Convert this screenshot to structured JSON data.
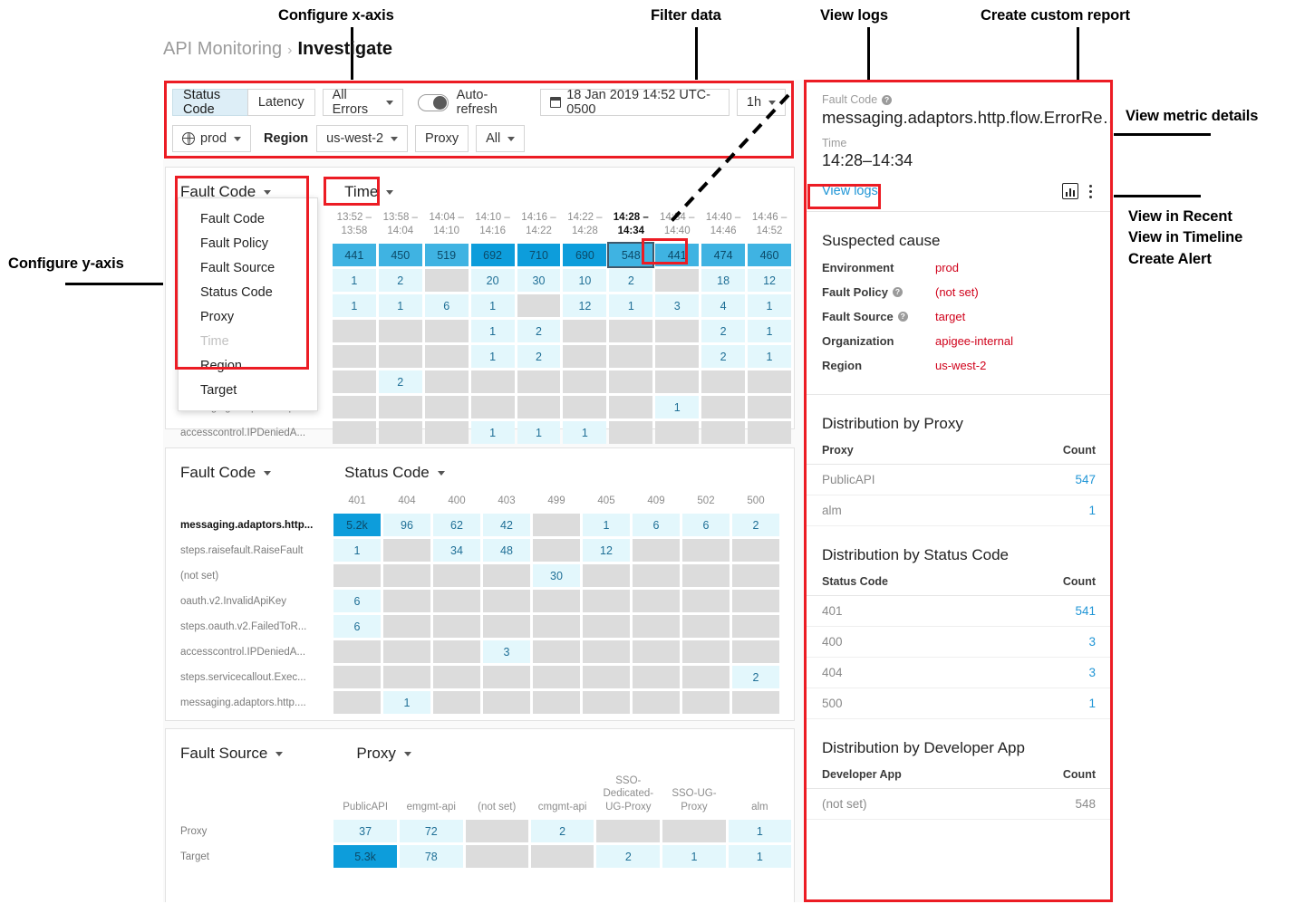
{
  "breadcrumb": {
    "root": "API Monitoring",
    "sep": "›",
    "current": "Investigate"
  },
  "annotations": [
    {
      "name": "configure-x-axis",
      "label": "Configure x-axis"
    },
    {
      "name": "filter-data",
      "label": "Filter data"
    },
    {
      "name": "view-logs",
      "label": "View logs"
    },
    {
      "name": "create-custom-report",
      "label": "Create custom report"
    },
    {
      "name": "view-metric-details",
      "label": "View metric details"
    },
    {
      "name": "view-in-recent",
      "label": "View in Recent"
    },
    {
      "name": "view-in-timeline",
      "label": "View in Timeline"
    },
    {
      "name": "create-alert",
      "label": "Create Alert"
    },
    {
      "name": "configure-y-axis",
      "label": "Configure y-axis"
    }
  ],
  "toolbar": {
    "metric_tabs": [
      {
        "label": "Status Code",
        "active": true
      },
      {
        "label": "Latency",
        "active": false
      }
    ],
    "errors_filter": "All Errors",
    "auto_refresh_label": "Auto-refresh",
    "auto_refresh_on": false,
    "date_range": "18 Jan 2019 14:52 UTC-0500",
    "window": "1h",
    "environment": "prod",
    "region_label": "Region",
    "region_value": "us-west-2",
    "proxy_label": "Proxy",
    "proxy_value": "All"
  },
  "ydropdown": {
    "trigger": "Fault Code",
    "options": [
      {
        "label": "Fault Code",
        "disabled": false
      },
      {
        "label": "Fault Policy",
        "disabled": false
      },
      {
        "label": "Fault Source",
        "disabled": false
      },
      {
        "label": "Status Code",
        "disabled": false
      },
      {
        "label": "Proxy",
        "disabled": false
      },
      {
        "label": "Time",
        "disabled": true
      },
      {
        "label": "Region",
        "disabled": false
      },
      {
        "label": "Target",
        "disabled": false
      }
    ]
  },
  "chart_data": [
    {
      "type": "heatmap",
      "name": "fault-code-by-time",
      "ylabel": "Fault Code",
      "xlabel": "Time",
      "categories": [
        "13:52 – 13:58",
        "13:58 – 14:04",
        "14:04 – 14:10",
        "14:10 – 14:16",
        "14:16 – 14:22",
        "14:22 – 14:28",
        "14:28 – 14:34",
        "14:34 – 14:40",
        "14:40 – 14:46",
        "14:46 – 14:52"
      ],
      "highlighted_column": 6,
      "selected_cell": {
        "row": 0,
        "col": 6
      },
      "marked_cell": {
        "row": 0,
        "col": 7
      },
      "rows": [
        {
          "label": "",
          "values": [
            441,
            450,
            519,
            692,
            710,
            690,
            548,
            441,
            474,
            460
          ]
        },
        {
          "label": "",
          "values": [
            1,
            2,
            null,
            20,
            30,
            10,
            2,
            null,
            18,
            12
          ]
        },
        {
          "label": "",
          "values": [
            1,
            1,
            6,
            1,
            null,
            12,
            1,
            3,
            4,
            1
          ]
        },
        {
          "label": "",
          "values": [
            null,
            null,
            null,
            1,
            2,
            null,
            null,
            null,
            2,
            1
          ]
        },
        {
          "label": "",
          "values": [
            null,
            null,
            null,
            1,
            2,
            null,
            null,
            null,
            2,
            1
          ]
        },
        {
          "label": "",
          "values": [
            null,
            2,
            null,
            null,
            null,
            null,
            null,
            null,
            null,
            null
          ]
        },
        {
          "label": "messaging.adaptors.http....",
          "values": [
            null,
            null,
            null,
            null,
            null,
            null,
            null,
            1,
            null,
            null
          ]
        },
        {
          "label": "accesscontrol.IPDeniedA...",
          "values": [
            null,
            null,
            null,
            1,
            1,
            1,
            null,
            null,
            null,
            null
          ]
        }
      ]
    },
    {
      "type": "heatmap",
      "name": "fault-code-by-status-code",
      "ylabel": "Fault Code",
      "xlabel": "Status Code",
      "categories": [
        "401",
        "404",
        "400",
        "403",
        "499",
        "405",
        "409",
        "502",
        "500"
      ],
      "rows": [
        {
          "label": "messaging.adaptors.http...",
          "bold": true,
          "values": [
            "5.2k",
            96,
            62,
            42,
            null,
            1,
            6,
            6,
            2
          ]
        },
        {
          "label": "steps.raisefault.RaiseFault",
          "values": [
            1,
            null,
            34,
            48,
            null,
            12,
            null,
            null,
            null
          ]
        },
        {
          "label": "(not set)",
          "values": [
            null,
            null,
            null,
            null,
            30,
            null,
            null,
            null,
            null
          ]
        },
        {
          "label": "oauth.v2.InvalidApiKey",
          "values": [
            6,
            null,
            null,
            null,
            null,
            null,
            null,
            null,
            null
          ]
        },
        {
          "label": "steps.oauth.v2.FailedToR...",
          "values": [
            6,
            null,
            null,
            null,
            null,
            null,
            null,
            null,
            null
          ]
        },
        {
          "label": "accesscontrol.IPDeniedA...",
          "values": [
            null,
            null,
            null,
            3,
            null,
            null,
            null,
            null,
            null
          ]
        },
        {
          "label": "steps.servicecallout.Exec...",
          "values": [
            null,
            null,
            null,
            null,
            null,
            null,
            null,
            null,
            2
          ]
        },
        {
          "label": "messaging.adaptors.http....",
          "values": [
            null,
            1,
            null,
            null,
            null,
            null,
            null,
            null,
            null
          ]
        }
      ]
    },
    {
      "type": "heatmap",
      "name": "fault-source-by-proxy",
      "ylabel": "Fault Source",
      "xlabel": "Proxy",
      "categories": [
        "PublicAPI",
        "emgmt-api",
        "(not set)",
        "cmgmt-api",
        "SSO-Dedicated-UG-Proxy",
        "SSO-UG-Proxy",
        "alm"
      ],
      "rows": [
        {
          "label": "Proxy",
          "values": [
            37,
            72,
            null,
            2,
            null,
            null,
            1
          ]
        },
        {
          "label": "Target",
          "values": [
            "5.3k",
            78,
            null,
            null,
            2,
            1,
            1
          ]
        }
      ]
    }
  ],
  "detail": {
    "fault_code_label": "Fault Code",
    "fault_code_value": "messaging.adaptors.http.flow.ErrorRe…",
    "time_label": "Time",
    "time_value": "14:28–14:34",
    "view_logs": "View logs",
    "suspected_cause_title": "Suspected cause",
    "suspected_cause": [
      {
        "key": "Environment",
        "value": "prod",
        "help": false
      },
      {
        "key": "Fault Policy",
        "value": "(not set)",
        "help": true
      },
      {
        "key": "Fault Source",
        "value": "target",
        "help": true
      },
      {
        "key": "Organization",
        "value": "apigee-internal",
        "help": false
      },
      {
        "key": "Region",
        "value": "us-west-2",
        "help": false
      }
    ],
    "distributions": [
      {
        "title": "Distribution by Proxy",
        "col1": "Proxy",
        "col2": "Count",
        "link_counts": true,
        "rows": [
          {
            "name": "PublicAPI",
            "count": "547"
          },
          {
            "name": "alm",
            "count": "1"
          }
        ]
      },
      {
        "title": "Distribution by Status Code",
        "col1": "Status Code",
        "col2": "Count",
        "link_counts": true,
        "rows": [
          {
            "name": "401",
            "count": "541"
          },
          {
            "name": "400",
            "count": "3"
          },
          {
            "name": "404",
            "count": "3"
          },
          {
            "name": "500",
            "count": "1"
          }
        ]
      },
      {
        "title": "Distribution by Developer App",
        "col1": "Developer App",
        "col2": "Count",
        "link_counts": false,
        "rows": [
          {
            "name": "(not set)",
            "count": "548"
          }
        ]
      }
    ]
  },
  "colors": {
    "accent_red": "#ec1c24",
    "heat_max": "#0d9ddb",
    "heat_high": "#6bc2e5",
    "heat_low": "#e3f7fc",
    "empty": "#dcdcdc",
    "link": "#2196d6",
    "value_red": "#d0021b"
  }
}
